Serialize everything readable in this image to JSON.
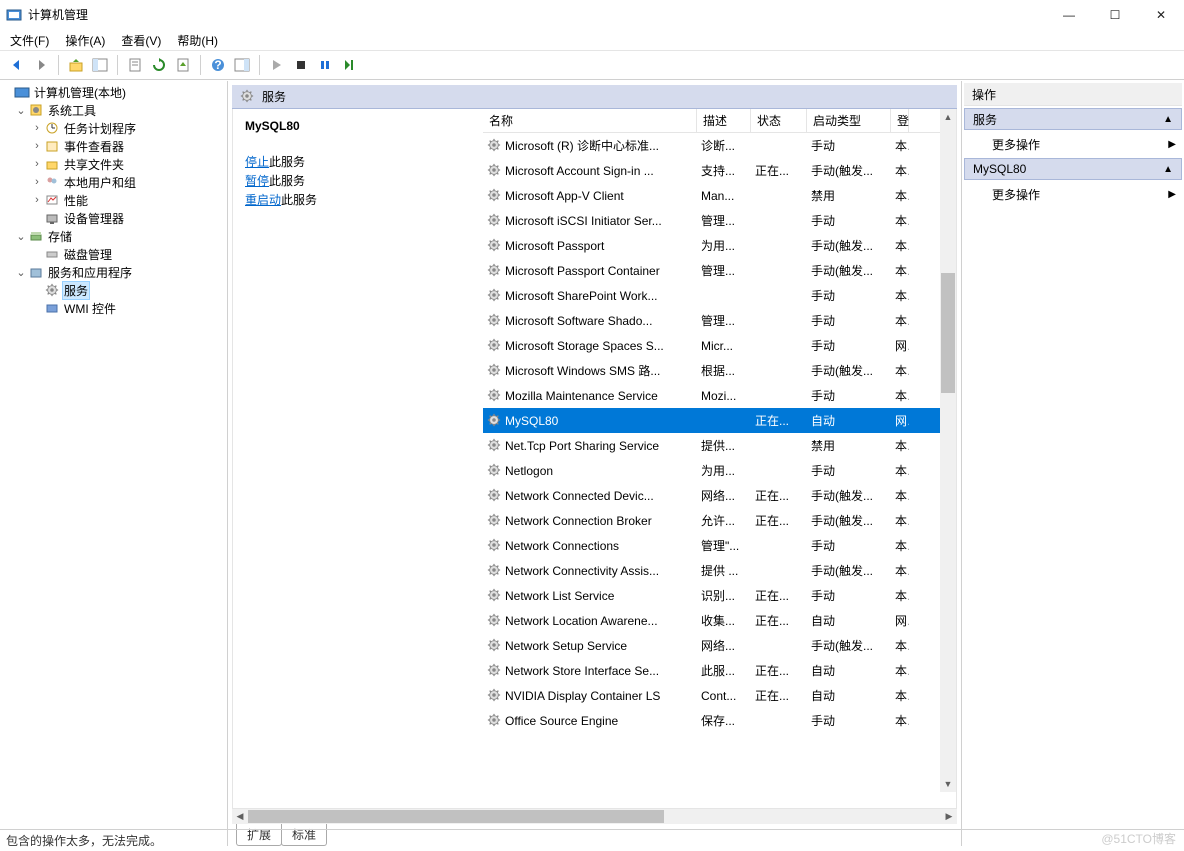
{
  "window": {
    "title": "计算机管理",
    "minimize": "—",
    "maximize": "☐",
    "close": "✕"
  },
  "menubar": [
    "文件(F)",
    "操作(A)",
    "查看(V)",
    "帮助(H)"
  ],
  "tree": {
    "root": "计算机管理(本地)",
    "system_tools": "系统工具",
    "task_scheduler": "任务计划程序",
    "event_viewer": "事件查看器",
    "shared_folders": "共享文件夹",
    "local_users": "本地用户和组",
    "performance": "性能",
    "device_manager": "设备管理器",
    "storage": "存储",
    "disk_mgmt": "磁盘管理",
    "services_apps": "服务和应用程序",
    "services": "服务",
    "wmi": "WMI 控件"
  },
  "services_header": "服务",
  "detail": {
    "selected": "MySQL80",
    "stop_link": "停止",
    "stop_suffix": "此服务",
    "pause_link": "暂停",
    "pause_suffix": "此服务",
    "restart_link": "重启动",
    "restart_suffix": "此服务"
  },
  "columns": {
    "name": "名称",
    "desc": "描述",
    "state": "状态",
    "start": "启动类型",
    "logon": "登"
  },
  "rows": [
    {
      "name": "Microsoft (R) 诊断中心标准...",
      "desc": "诊断...",
      "state": "",
      "start": "手动",
      "logon": "本"
    },
    {
      "name": "Microsoft Account Sign-in ...",
      "desc": "支持...",
      "state": "正在...",
      "start": "手动(触发...",
      "logon": "本"
    },
    {
      "name": "Microsoft App-V Client",
      "desc": "Man...",
      "state": "",
      "start": "禁用",
      "logon": "本"
    },
    {
      "name": "Microsoft iSCSI Initiator Ser...",
      "desc": "管理...",
      "state": "",
      "start": "手动",
      "logon": "本"
    },
    {
      "name": "Microsoft Passport",
      "desc": "为用...",
      "state": "",
      "start": "手动(触发...",
      "logon": "本"
    },
    {
      "name": "Microsoft Passport Container",
      "desc": "管理...",
      "state": "",
      "start": "手动(触发...",
      "logon": "本"
    },
    {
      "name": "Microsoft SharePoint Work...",
      "desc": "",
      "state": "",
      "start": "手动",
      "logon": "本"
    },
    {
      "name": "Microsoft Software Shado...",
      "desc": "管理...",
      "state": "",
      "start": "手动",
      "logon": "本"
    },
    {
      "name": "Microsoft Storage Spaces S...",
      "desc": "Micr...",
      "state": "",
      "start": "手动",
      "logon": "网"
    },
    {
      "name": "Microsoft Windows SMS 路...",
      "desc": "根据...",
      "state": "",
      "start": "手动(触发...",
      "logon": "本"
    },
    {
      "name": "Mozilla Maintenance Service",
      "desc": "Mozi...",
      "state": "",
      "start": "手动",
      "logon": "本"
    },
    {
      "name": "MySQL80",
      "desc": "",
      "state": "正在...",
      "start": "自动",
      "logon": "网",
      "selected": true
    },
    {
      "name": "Net.Tcp Port Sharing Service",
      "desc": "提供...",
      "state": "",
      "start": "禁用",
      "logon": "本"
    },
    {
      "name": "Netlogon",
      "desc": "为用...",
      "state": "",
      "start": "手动",
      "logon": "本"
    },
    {
      "name": "Network Connected Devic...",
      "desc": "网络...",
      "state": "正在...",
      "start": "手动(触发...",
      "logon": "本"
    },
    {
      "name": "Network Connection Broker",
      "desc": "允许...",
      "state": "正在...",
      "start": "手动(触发...",
      "logon": "本"
    },
    {
      "name": "Network Connections",
      "desc": "管理\"...",
      "state": "",
      "start": "手动",
      "logon": "本"
    },
    {
      "name": "Network Connectivity Assis...",
      "desc": "提供 ...",
      "state": "",
      "start": "手动(触发...",
      "logon": "本"
    },
    {
      "name": "Network List Service",
      "desc": "识别...",
      "state": "正在...",
      "start": "手动",
      "logon": "本"
    },
    {
      "name": "Network Location Awarene...",
      "desc": "收集...",
      "state": "正在...",
      "start": "自动",
      "logon": "网"
    },
    {
      "name": "Network Setup Service",
      "desc": "网络...",
      "state": "",
      "start": "手动(触发...",
      "logon": "本"
    },
    {
      "name": "Network Store Interface Se...",
      "desc": "此服...",
      "state": "正在...",
      "start": "自动",
      "logon": "本"
    },
    {
      "name": "NVIDIA Display Container LS",
      "desc": "Cont...",
      "state": "正在...",
      "start": "自动",
      "logon": "本"
    },
    {
      "name": "Office  Source Engine",
      "desc": "保存...",
      "state": "",
      "start": "手动",
      "logon": "本"
    }
  ],
  "tabs": {
    "ext": "扩展",
    "std": "标准"
  },
  "actions": {
    "header": "操作",
    "section1": "服务",
    "more1": "更多操作",
    "section2": "MySQL80",
    "more2": "更多操作"
  },
  "status": "包含的操作太多，无法完成。",
  "watermark": "@51CTO博客"
}
